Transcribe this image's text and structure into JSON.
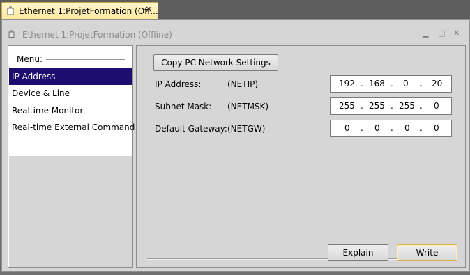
{
  "tab": {
    "title": "Ethernet 1:ProjetFormation  (Off...",
    "close": "✕"
  },
  "window": {
    "title": "Ethernet 1:ProjetFormation  (Offline)",
    "minimize": "▁",
    "maximize": "□",
    "close": "✕"
  },
  "menu": {
    "label": "Menu:",
    "items": [
      {
        "label": "IP Address",
        "selected": true
      },
      {
        "label": "Device & Line",
        "selected": false
      },
      {
        "label": "Realtime Monitor",
        "selected": false
      },
      {
        "label": "Real-time External Command",
        "selected": false
      }
    ]
  },
  "panel": {
    "copy_button": "Copy PC Network Settings",
    "rows": [
      {
        "label": "IP Address:",
        "code": "(NETIP)",
        "octets": [
          "192",
          "168",
          "0",
          "20"
        ]
      },
      {
        "label": "Subnet Mask:",
        "code": "(NETMSK)",
        "octets": [
          "255",
          "255",
          "255",
          "0"
        ]
      },
      {
        "label": "Default Gateway:",
        "code": "(NETGW)",
        "octets": [
          "0",
          "0",
          "0",
          "0"
        ]
      }
    ],
    "dot": ".",
    "explain_button": "Explain",
    "write_button": "Write"
  },
  "colors": {
    "selected_bg": "#1c0d6e",
    "tab_bg": "#fde8a0",
    "write_border": "#d9b24a"
  }
}
